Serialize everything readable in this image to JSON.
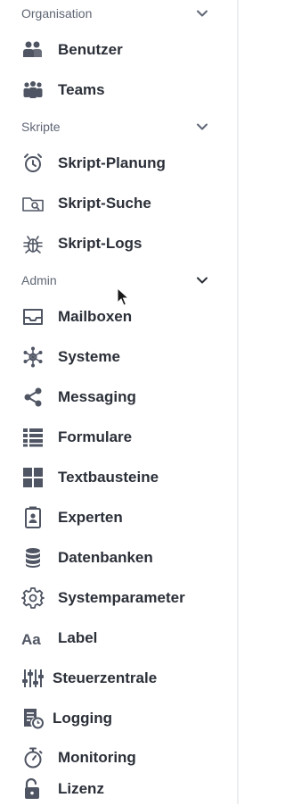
{
  "sections": {
    "organisation": {
      "title": "Organisation",
      "items": [
        {
          "label": "Benutzer",
          "icon": "users-icon"
        },
        {
          "label": "Teams",
          "icon": "team-icon"
        }
      ]
    },
    "skripte": {
      "title": "Skripte",
      "items": [
        {
          "label": "Skript-Planung",
          "icon": "alarm-clock-icon"
        },
        {
          "label": "Skript-Suche",
          "icon": "folder-search-icon"
        },
        {
          "label": "Skript-Logs",
          "icon": "bug-icon"
        }
      ]
    },
    "admin": {
      "title": "Admin",
      "items": [
        {
          "label": "Mailboxen",
          "icon": "inbox-icon"
        },
        {
          "label": "Systeme",
          "icon": "network-hub-icon"
        },
        {
          "label": "Messaging",
          "icon": "share-icon"
        },
        {
          "label": "Formulare",
          "icon": "form-list-icon"
        },
        {
          "label": "Textbausteine",
          "icon": "grid-blocks-icon"
        },
        {
          "label": "Experten",
          "icon": "badge-icon"
        },
        {
          "label": "Datenbanken",
          "icon": "database-icon"
        },
        {
          "label": "Systemparameter",
          "icon": "gear-icon"
        },
        {
          "label": "Label",
          "icon": "text-format-icon"
        },
        {
          "label": "Steuerzentrale",
          "icon": "sliders-icon"
        },
        {
          "label": "Logging",
          "icon": "log-file-icon"
        },
        {
          "label": "Monitoring",
          "icon": "timer-icon"
        },
        {
          "label": "Lizenz",
          "icon": "unlock-icon"
        }
      ]
    }
  },
  "colors": {
    "icon": "#4f5563",
    "text": "#2b2f38",
    "section_text": "#5f6675",
    "background": "#ffffff"
  }
}
